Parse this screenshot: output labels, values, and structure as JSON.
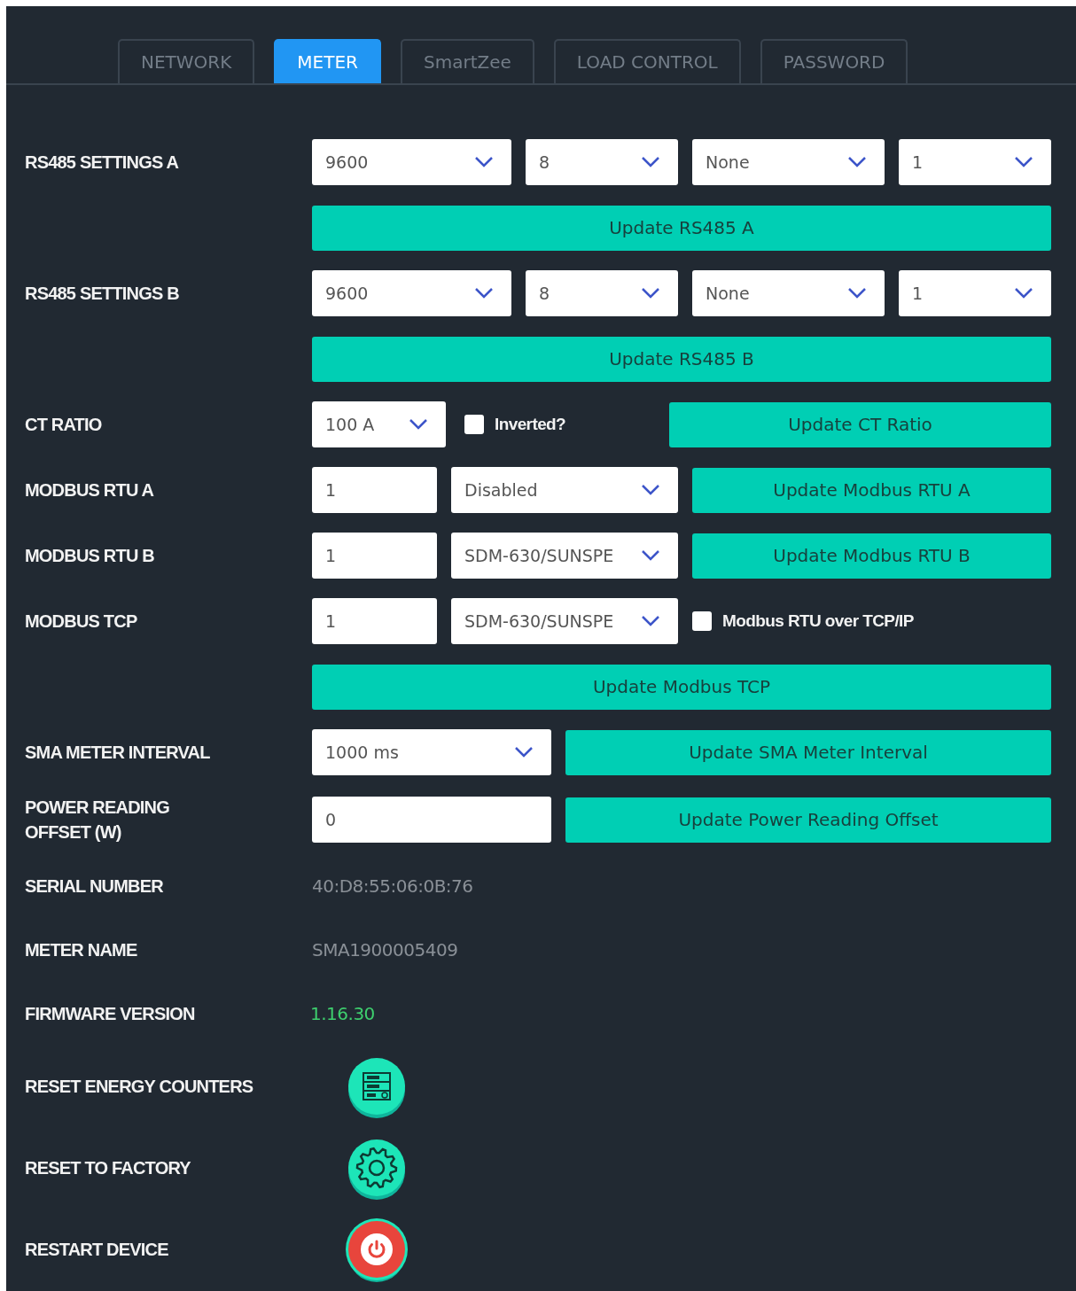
{
  "tabs": [
    {
      "label": "NETWORK",
      "selected": false
    },
    {
      "label": "METER",
      "selected": true
    },
    {
      "label": "SmartZee",
      "selected": false
    },
    {
      "label": "LOAD CONTROL",
      "selected": false
    },
    {
      "label": "PASSWORD",
      "selected": false
    }
  ],
  "rows": [
    {
      "label": "RS485 SETTINGS A",
      "controls": [
        {
          "kind": "select",
          "value": "9600"
        },
        {
          "kind": "select",
          "value": "8"
        },
        {
          "kind": "select",
          "value": "None"
        },
        {
          "kind": "select",
          "value": "1"
        }
      ]
    },
    {
      "controls": [
        {
          "kind": "button",
          "label": "Update RS485 A"
        }
      ]
    },
    {
      "label": "RS485 SETTINGS B",
      "controls": [
        {
          "kind": "select",
          "value": "9600"
        },
        {
          "kind": "select",
          "value": "8"
        },
        {
          "kind": "select",
          "value": "None"
        },
        {
          "kind": "select",
          "value": "1"
        }
      ]
    },
    {
      "controls": [
        {
          "kind": "button",
          "label": "Update RS485 B"
        }
      ]
    },
    {
      "label": "CT RATIO",
      "controls": [
        {
          "kind": "select",
          "value": "100 A"
        },
        {
          "kind": "checkbox",
          "label": "Inverted?",
          "checked": false
        },
        {
          "kind": "button",
          "label": "Update CT Ratio"
        }
      ]
    },
    {
      "label": "MODBUS RTU A",
      "controls": [
        {
          "kind": "input",
          "value": "1"
        },
        {
          "kind": "select",
          "value": "Disabled"
        },
        {
          "kind": "button",
          "label": "Update Modbus RTU A"
        }
      ]
    },
    {
      "label": "MODBUS RTU B",
      "controls": [
        {
          "kind": "input",
          "value": "1"
        },
        {
          "kind": "select",
          "value": "SDM-630/SUNSPE"
        },
        {
          "kind": "button",
          "label": "Update Modbus RTU B"
        }
      ]
    },
    {
      "label": "MODBUS TCP",
      "controls": [
        {
          "kind": "input",
          "value": "1"
        },
        {
          "kind": "select",
          "value": "SDM-630/SUNSPE"
        },
        {
          "kind": "checkbox",
          "label": "Modbus RTU over TCP/IP",
          "checked": false
        }
      ]
    },
    {
      "controls": [
        {
          "kind": "button",
          "label": "Update Modbus TCP"
        }
      ]
    },
    {
      "label": "SMA METER INTERVAL",
      "controls": [
        {
          "kind": "select",
          "value": "1000 ms"
        },
        {
          "kind": "button",
          "label": "Update SMA Meter Interval"
        }
      ]
    },
    {
      "label": "POWER READING OFFSET (W)",
      "controls": [
        {
          "kind": "input",
          "value": "0"
        },
        {
          "kind": "button",
          "label": "Update Power Reading Offset"
        }
      ]
    },
    {
      "label": "SERIAL NUMBER",
      "controls": [
        {
          "kind": "text",
          "value": "40:D8:55:06:0B:76",
          "color": "#8a9097"
        }
      ]
    },
    {
      "label": "METER NAME",
      "controls": [
        {
          "kind": "text",
          "value": "SMA1900005409",
          "color": "#8a9097"
        }
      ]
    },
    {
      "label": "FIRMWARE VERSION",
      "controls": [
        {
          "kind": "text",
          "value": "1.16.30",
          "color": "#3ecf6e"
        }
      ]
    },
    {
      "label": "RESET ENERGY COUNTERS",
      "controls": [
        {
          "kind": "round"
        }
      ]
    },
    {
      "label": "RESET TO FACTORY",
      "controls": [
        {
          "kind": "round"
        }
      ]
    },
    {
      "label": "RESTART DEVICE",
      "controls": [
        {
          "kind": "round"
        }
      ]
    }
  ]
}
